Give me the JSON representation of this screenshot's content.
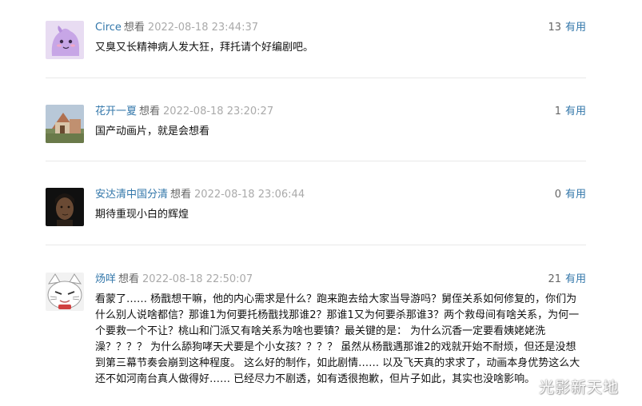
{
  "comments": [
    {
      "user": "Circe",
      "rating": "想看",
      "time": "2022-08-18 23:44:37",
      "votes": "13",
      "useful_label": "有用",
      "content": "又臭又长精神病人发大狂，拜托请个好编剧吧。"
    },
    {
      "user": "花开一夏",
      "rating": "想看",
      "time": "2022-08-18 23:20:27",
      "votes": "1",
      "useful_label": "有用",
      "content": "国产动画片，就是会想看"
    },
    {
      "user": "安达清中国分清",
      "rating": "想看",
      "time": "2022-08-18 23:06:44",
      "votes": "0",
      "useful_label": "有用",
      "content": "期待重现小白的辉煌"
    },
    {
      "user": "炀咩",
      "rating": "想看",
      "time": "2022-08-18 22:50:07",
      "votes": "21",
      "useful_label": "有用",
      "content_lines": [
        "看蒙了…… 杨戬想干嘛，他的内心需求是什么？跑来跑去给大家当导游吗？舅侄关系如何修复的，你们为",
        "什么别人说啥都信？那谁1为何要托杨戬找那谁2？那谁1又为何要杀那谁3？两个救母间有啥关系，为何一",
        "个要救一个不让？桃山和门派又有啥关系为啥也要镇？最关键的是： 为什么沉香一定要看姨姥姥洗",
        "澡？？？？ 为什么舔狗哮天犬要是个小女孩？？？？ 虽然从杨戬遇那谁2的戏就开始不耐烦，但还是没想",
        "到第三幕节奏会崩到这种程度。 这么好的制作，如此剧情…… 以及飞天真的求求了，动画本身优势这么大",
        "还不如河南台真人做得好…… 已经尽力不剧透，如有透很抱歉，但片子如此，其实也没啥影响。"
      ]
    }
  ],
  "watermark": "光影新天地",
  "colors": {
    "link": "#3377aa",
    "meta": "#aaaaaa",
    "text": "#111111",
    "divider": "#e9e9e9"
  }
}
